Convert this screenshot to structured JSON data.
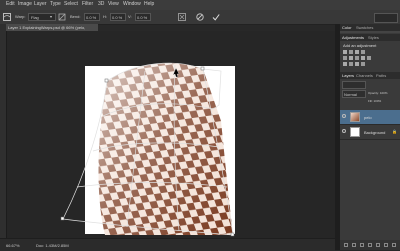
{
  "menu": {
    "items": [
      "Edit",
      "Image",
      "Layer",
      "Type",
      "Select",
      "Filter",
      "3D",
      "View",
      "Window",
      "Help"
    ]
  },
  "options": {
    "warp_label": "Warp:",
    "warp_value": "Flag",
    "bend_label": "Bend:",
    "bend_value": "0.0 %",
    "h_label": "H:",
    "h_value": "0.0 %",
    "v_label": "V:",
    "v_value": "0.0 %"
  },
  "document": {
    "tab_title": "Layer 1 ExplainingWarps.psd @ 66% (pelo, RGB/8)"
  },
  "status": {
    "zoom": "66.67%",
    "doc_info": "Doc: 1.43M/2.85M"
  },
  "panels": {
    "top_tabs": [
      "Color",
      "Swatches"
    ],
    "adjust_tabs": [
      "Adjustments",
      "Styles"
    ],
    "add_adjustment_label": "Add an adjustment",
    "layers_tabs": [
      "Layers",
      "Channels",
      "Paths"
    ],
    "blend_mode": "Normal",
    "opacity": "Opacity: 100%",
    "fill": "Fill: 100%",
    "layers": [
      {
        "name": "pelo"
      },
      {
        "name": "Background"
      }
    ]
  },
  "colors": {
    "accent": "#6b2e18",
    "checker_light": "#f5e3d8",
    "selection": "#4b6e8e"
  }
}
